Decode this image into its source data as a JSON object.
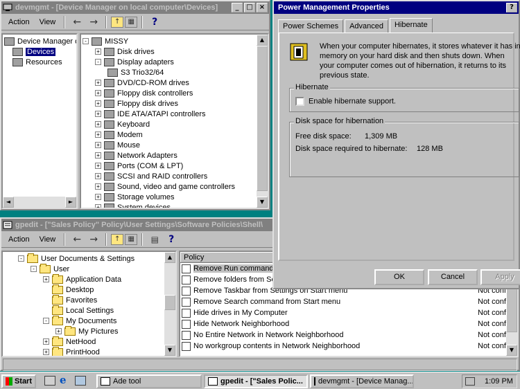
{
  "devmgmt": {
    "title": "devmgmt - [Device Manager on local computer\\Devices]",
    "menu": [
      "Action",
      "View"
    ],
    "left_tree": [
      "Device Manager or",
      "Devices",
      "Resources"
    ],
    "root": "MISSY",
    "items": [
      {
        "label": "Disk drives",
        "expander": "+"
      },
      {
        "label": "Display adapters",
        "expander": "-"
      },
      {
        "label": "S3 Trio32/64",
        "child": true
      },
      {
        "label": "DVD/CD-ROM drives",
        "expander": "+"
      },
      {
        "label": "Floppy disk controllers",
        "expander": "+"
      },
      {
        "label": "Floppy disk drives",
        "expander": "+"
      },
      {
        "label": "IDE ATA/ATAPI controllers",
        "expander": "+"
      },
      {
        "label": "Keyboard",
        "expander": "+"
      },
      {
        "label": "Modem",
        "expander": "+"
      },
      {
        "label": "Mouse",
        "expander": "+"
      },
      {
        "label": "Network Adapters",
        "expander": "+"
      },
      {
        "label": "Ports (COM & LPT)",
        "expander": "+"
      },
      {
        "label": "SCSI and RAID controllers",
        "expander": "+"
      },
      {
        "label": "Sound, video and game controllers",
        "expander": "+"
      },
      {
        "label": "Storage volumes",
        "expander": "+"
      },
      {
        "label": "System devices",
        "expander": "+"
      }
    ]
  },
  "gpedit": {
    "title": "gpedit - [\"Sales Policy\" Policy\\User Settings\\Software Policies\\Shell\\",
    "menu": [
      "Action",
      "View"
    ],
    "tree": [
      {
        "label": "User Documents & Settings",
        "indent": 0,
        "expander": "-"
      },
      {
        "label": "User",
        "indent": 1,
        "expander": "-"
      },
      {
        "label": "Application Data",
        "indent": 2,
        "expander": "+"
      },
      {
        "label": "Desktop",
        "indent": 2,
        "expander": ""
      },
      {
        "label": "Favorites",
        "indent": 2,
        "expander": ""
      },
      {
        "label": "Local Settings",
        "indent": 2,
        "expander": ""
      },
      {
        "label": "My Documents",
        "indent": 2,
        "expander": "-"
      },
      {
        "label": "My Pictures",
        "indent": 3,
        "expander": "+"
      },
      {
        "label": "NetHood",
        "indent": 2,
        "expander": "+"
      },
      {
        "label": "PrintHood",
        "indent": 2,
        "expander": "+"
      }
    ],
    "list_header": "Policy",
    "policies": [
      {
        "name": "Remove Run command fr",
        "state": ""
      },
      {
        "name": "Remove folders from Setti",
        "state": ""
      },
      {
        "name": "Remove Taskbar from Settings on Start menu",
        "state": "Not confi"
      },
      {
        "name": "Remove Search command from Start menu",
        "state": "Not confi"
      },
      {
        "name": "Hide drives in My Computer",
        "state": "Not confi"
      },
      {
        "name": "Hide Network Neighborhood",
        "state": "Not confi"
      },
      {
        "name": "No Entire Network in Network Neighborhood",
        "state": "Not confi"
      },
      {
        "name": "No workgroup contents in Network Neighborhood",
        "state": "Not confi"
      }
    ]
  },
  "power": {
    "title": "Power Management Properties",
    "tabs": [
      "Power Schemes",
      "Advanced",
      "Hibernate"
    ],
    "active_tab": "Hibernate",
    "description": "When your computer hibernates, it stores whatever it has in memory on your hard disk and then shuts down. When your computer comes out of hibernation, it returns to its previous state.",
    "hibernate_group": "Hibernate",
    "enable_label": "Enable hibernate support.",
    "enable_checked": false,
    "disk_group": "Disk space for hibernation",
    "free_label": "Free disk space:",
    "free_value": "1,309 MB",
    "required_label": "Disk space required to hibernate:",
    "required_value": "128 MB",
    "ok": "OK",
    "cancel": "Cancel",
    "apply": "Apply"
  },
  "taskbar": {
    "start": "Start",
    "tasks": [
      "Ade tool",
      "gpedit - [\"Sales Polic...",
      "devmgmt - [Device Manag..."
    ],
    "time": "1:09 PM"
  }
}
